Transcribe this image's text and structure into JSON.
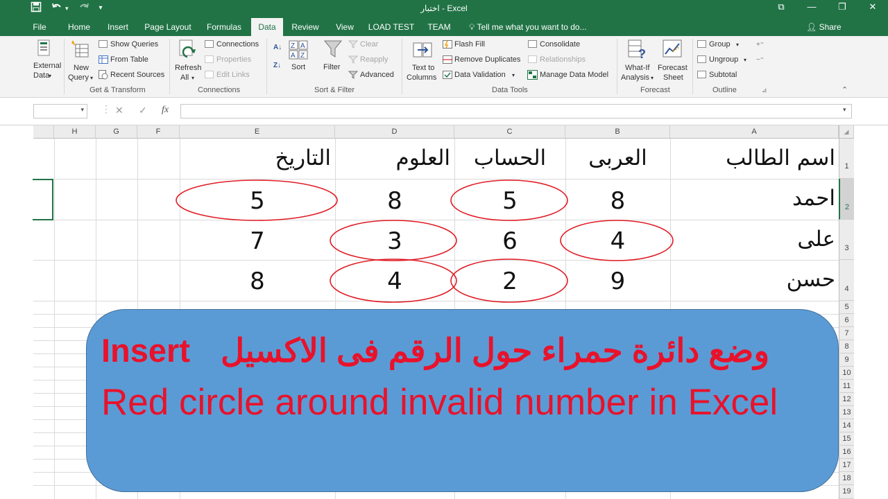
{
  "titlebar": {
    "title": "اختبار - Excel",
    "quick_access": {
      "save_icon": "save-icon",
      "undo_icon": "undo-icon",
      "redo_icon": "redo-icon",
      "customize_icon": "customize-qat-icon"
    },
    "window_controls": [
      "ribbon-display-icon",
      "minimize-icon",
      "restore-icon",
      "close-icon"
    ]
  },
  "tabs": [
    "File",
    "Home",
    "Insert",
    "Page Layout",
    "Formulas",
    "Data",
    "Review",
    "View",
    "LOAD TEST",
    "TEAM"
  ],
  "active_tab": "Data",
  "tell_me": "Tell me what you want to do...",
  "share": "Share",
  "ribbon": {
    "external_data": {
      "line1": "External",
      "line2": "Data"
    },
    "get_transform": {
      "new_query_line1": "New",
      "new_query_line2": "Query",
      "show_queries": "Show Queries",
      "from_table": "From Table",
      "recent_sources": "Recent Sources",
      "group": "Get & Transform"
    },
    "connections": {
      "refresh_line1": "Refresh",
      "refresh_line2": "All",
      "connections": "Connections",
      "properties": "Properties",
      "edit_links": "Edit Links",
      "group": "Connections"
    },
    "sort_filter": {
      "sort": "Sort",
      "filter": "Filter",
      "clear": "Clear",
      "reapply": "Reapply",
      "advanced": "Advanced",
      "group": "Sort & Filter"
    },
    "data_tools": {
      "text_to_columns_line1": "Text to",
      "text_to_columns_line2": "Columns",
      "flash_fill": "Flash Fill",
      "remove_duplicates": "Remove Duplicates",
      "data_validation": "Data Validation",
      "consolidate": "Consolidate",
      "relationships": "Relationships",
      "manage_data_model": "Manage Data Model",
      "group": "Data Tools"
    },
    "forecast": {
      "what_if_line1": "What-If",
      "what_if_line2": "Analysis",
      "forecast_sheet_line1": "Forecast",
      "forecast_sheet_line2": "Sheet",
      "group": "Forecast"
    },
    "outline": {
      "group_btn": "Group",
      "ungroup": "Ungroup",
      "subtotal": "Subtotal",
      "group": "Outline"
    }
  },
  "formula_bar": {
    "cancel_symbol": "✕",
    "enter_symbol": "✓",
    "fx": "fx",
    "value": ""
  },
  "columns": [
    "H",
    "G",
    "F",
    "E",
    "D",
    "C",
    "B",
    "A"
  ],
  "rows": [
    "1",
    "2",
    "3",
    "4",
    "5",
    "6",
    "7",
    "8",
    "9",
    "10",
    "11",
    "12",
    "13",
    "14",
    "15",
    "16",
    "17",
    "18",
    "19"
  ],
  "sheet": {
    "headers": {
      "A": "اسم الطالب",
      "B": "العربى",
      "C": "الحساب",
      "D": "العلوم",
      "E": "التاريخ"
    },
    "students": [
      {
        "name": "احمد",
        "B": "8",
        "C": "5",
        "D": "8",
        "E": "5"
      },
      {
        "name": "على",
        "B": "4",
        "C": "6",
        "D": "3",
        "E": "7"
      },
      {
        "name": "حسن",
        "B": "9",
        "C": "2",
        "D": "4",
        "E": "8"
      }
    ],
    "invalid_circles": [
      "C2",
      "E2",
      "B3",
      "D3",
      "C4",
      "D4"
    ],
    "circle_color": "#e01b24"
  },
  "banner": {
    "arabic": "وضع دائرة حمراء حول الرقم فى الاكسيل",
    "insert": "Insert",
    "english": "Red circle around invalid number in Excel",
    "fill": "#5b9bd5",
    "text_color": "#e8122b"
  }
}
